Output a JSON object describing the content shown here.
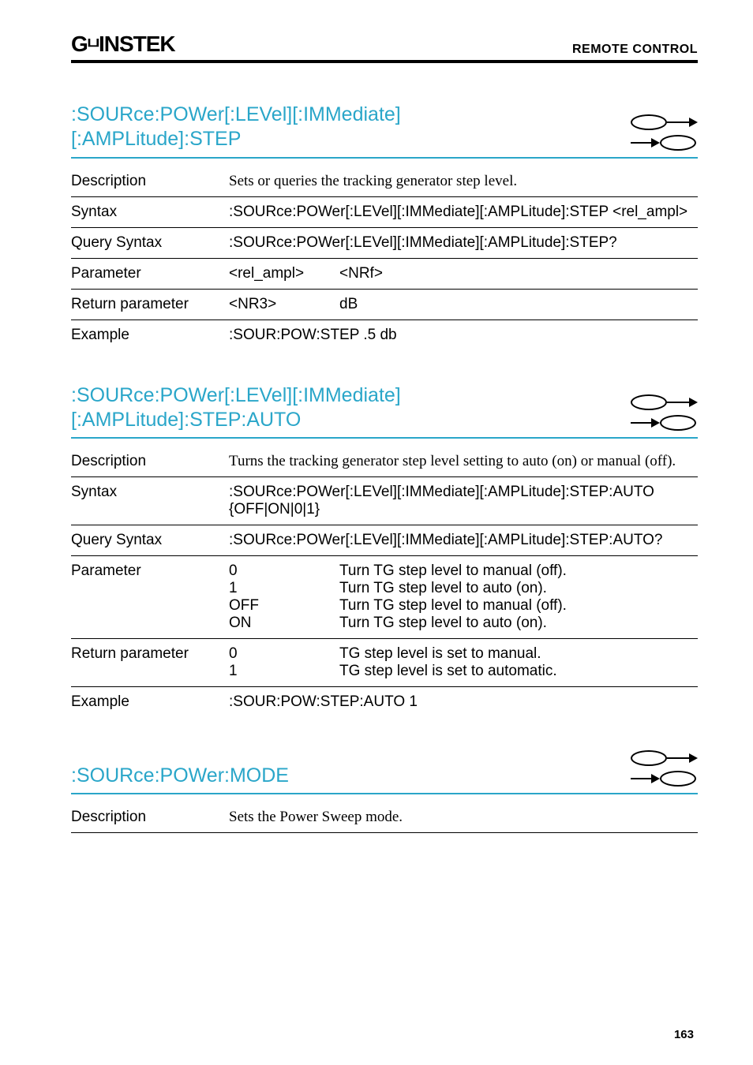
{
  "header": {
    "logo_text": "GWINSTEK",
    "right": "REMOTE CONTROL"
  },
  "sections": [
    {
      "title_line1": ":SOURce:POWer[:LEVel][:IMMediate]",
      "title_line2": "[:AMPLitude]:STEP",
      "arrows": "both",
      "rows": [
        {
          "label": "Description",
          "value_serif": "Sets or queries the tracking generator step level."
        },
        {
          "label": "Syntax",
          "value_mono": ":SOURce:POWer[:LEVel][:IMMediate][:AMPLitude]:STEP <rel_ampl>"
        },
        {
          "label": "Query Syntax",
          "value_mono": ":SOURce:POWer[:LEVel][:IMMediate][:AMPLitude]:STEP?"
        },
        {
          "label": "Parameter",
          "sub_a": "<rel_ampl>",
          "sub_b": "<NRf>"
        },
        {
          "label": "Return parameter",
          "sub_a": "<NR3>",
          "sub_b": "dB"
        },
        {
          "label": "Example",
          "value_mono": ":SOUR:POW:STEP .5 db"
        }
      ]
    },
    {
      "title_line1": ":SOURce:POWer[:LEVel][:IMMediate]",
      "title_line2": "[:AMPLitude]:STEP:AUTO",
      "arrows": "both",
      "rows": [
        {
          "label": "Description",
          "value_serif": "Turns the tracking generator step level setting to auto (on) or manual (off)."
        },
        {
          "label": "Syntax",
          "value_mono": ":SOURce:POWer[:LEVel][:IMMediate][:AMPLitude]:STEP:AUTO {OFF|ON|0|1}"
        },
        {
          "label": "Query Syntax",
          "value_mono": ":SOURce:POWer[:LEVel][:IMMediate][:AMPLitude]:STEP:AUTO?"
        },
        {
          "label": "Parameter",
          "multi": [
            {
              "a": "0",
              "b": "Turn TG step level to manual (off)."
            },
            {
              "a": "1",
              "b": "Turn TG step level to auto (on)."
            },
            {
              "a": "OFF",
              "b": "Turn TG step level to manual (off)."
            },
            {
              "a": "ON",
              "b": "Turn TG step level to auto (on)."
            }
          ]
        },
        {
          "label": "Return parameter",
          "multi": [
            {
              "a": "0",
              "b": "TG step level is set to manual."
            },
            {
              "a": "1",
              "b": "TG step level is set to automatic."
            }
          ]
        },
        {
          "label": "Example",
          "value_mono": ":SOUR:POW:STEP:AUTO 1"
        }
      ]
    },
    {
      "title_line1": ":SOURce:POWer:MODE",
      "title_line2": "",
      "arrows": "both",
      "rows": [
        {
          "label": "Description",
          "value_serif": "Sets the Power Sweep mode."
        }
      ]
    }
  ],
  "page_number": "163"
}
